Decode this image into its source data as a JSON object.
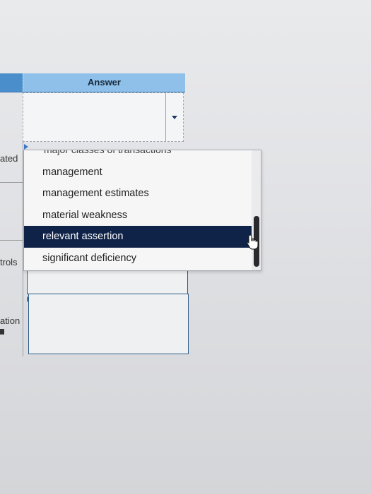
{
  "table": {
    "answer_header": "Answer",
    "row_labels": [
      "ated",
      "trols",
      "ation"
    ]
  },
  "dropdown": {
    "partial_item": "major classes of transactions",
    "options": [
      "management",
      "management estimates",
      "material weakness",
      "relevant assertion",
      "significant deficiency"
    ],
    "selected": "relevant assertion"
  },
  "colors": {
    "header": "#8ec0ea",
    "selected_bg": "#0f2247",
    "field_border": "#2d5b8a"
  },
  "icons": {
    "dropdown_arrow": "caret-down-icon",
    "cursor": "hand-pointer-icon"
  }
}
